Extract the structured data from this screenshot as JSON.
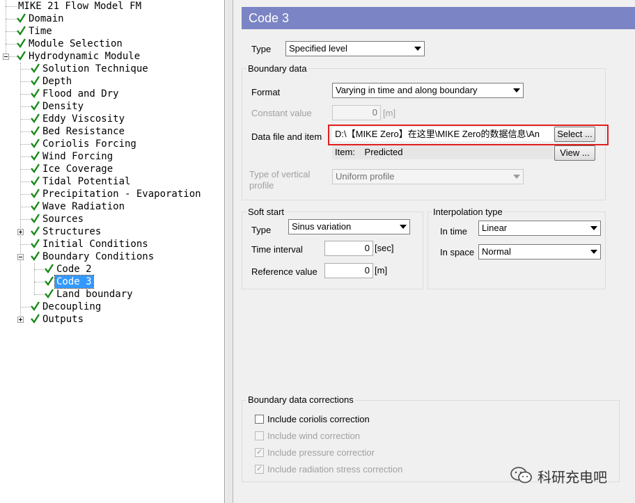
{
  "tree": {
    "items": [
      {
        "label": "MIKE 21 Flow Model FM"
      },
      {
        "label": "Domain"
      },
      {
        "label": "Time"
      },
      {
        "label": "Module Selection"
      },
      {
        "label": "Hydrodynamic Module"
      },
      {
        "label": "Solution Technique"
      },
      {
        "label": "Depth"
      },
      {
        "label": "Flood and Dry"
      },
      {
        "label": "Density"
      },
      {
        "label": "Eddy Viscosity"
      },
      {
        "label": "Bed Resistance"
      },
      {
        "label": "Coriolis Forcing"
      },
      {
        "label": "Wind Forcing"
      },
      {
        "label": "Ice Coverage"
      },
      {
        "label": "Tidal Potential"
      },
      {
        "label": "Precipitation - Evaporation"
      },
      {
        "label": "Wave Radiation"
      },
      {
        "label": "Sources"
      },
      {
        "label": "Structures"
      },
      {
        "label": "Initial Conditions"
      },
      {
        "label": "Boundary Conditions"
      },
      {
        "label": "Code 2"
      },
      {
        "label": "Code 3"
      },
      {
        "label": "Land boundary"
      },
      {
        "label": "Decoupling"
      },
      {
        "label": "Outputs"
      }
    ],
    "selected": "Code 3",
    "check_color": "#1a8a1a"
  },
  "panel": {
    "title": "Code 3",
    "header_color": "#7b84c4",
    "type_label": "Type",
    "type_value": "Specified level",
    "boundary_data": {
      "title": "Boundary data",
      "format_label": "Format",
      "format_value": "Varying in time and along boundary",
      "constant_label": "Constant value",
      "constant_value": "0",
      "constant_unit": "[m]",
      "datafile_label": "Data file and item",
      "datafile_path": "D:\\【MIKE Zero】在这里\\MIKE Zero的数据信息\\An",
      "select_button": "Select ...",
      "item_label": "Item:",
      "item_value": "Predicted",
      "view_button": "View ...",
      "vertical_label_1": "Type of vertical",
      "vertical_label_2": "profile",
      "vertical_value": "Uniform profile"
    },
    "soft_start": {
      "title": "Soft start",
      "type_label": "Type",
      "type_value": "Sinus variation",
      "interval_label": "Time interval",
      "interval_value": "0",
      "interval_unit": "[sec]",
      "reference_label": "Reference value",
      "reference_value": "0",
      "reference_unit": "[m]"
    },
    "interpolation": {
      "title": "Interpolation type",
      "time_label": "In time",
      "time_value": "Linear",
      "space_label": "In space",
      "space_value": "Normal"
    },
    "corrections": {
      "title": "Boundary data corrections",
      "items": [
        {
          "label": "Include coriolis correction",
          "checked": false,
          "enabled": true
        },
        {
          "label": "Include wind correction",
          "checked": false,
          "enabled": false
        },
        {
          "label": "Include pressure correctior",
          "checked": true,
          "enabled": false
        },
        {
          "label": "Include radiation stress correction",
          "checked": true,
          "enabled": false
        }
      ]
    },
    "highlight_color": "#e21d1d"
  },
  "watermark": {
    "text": "科研充电吧",
    "icon": "wechat-icon"
  }
}
